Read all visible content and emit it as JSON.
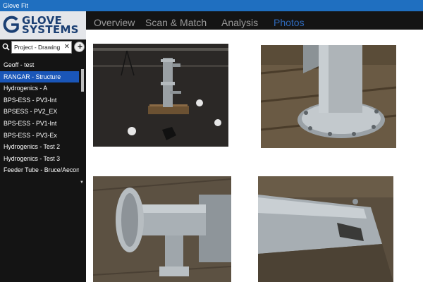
{
  "app": {
    "title": "Glove Fit"
  },
  "brand": {
    "line1": "GLOVE",
    "line2": "SYSTEMS"
  },
  "search": {
    "value": "Project - Drawing",
    "clear_glyph": "✕"
  },
  "sidebar": {
    "add_glyph": "+",
    "items": [
      {
        "label": "Geoff - test"
      },
      {
        "label": "RANGAR - Structure",
        "selected": true
      },
      {
        "label": "Hydrogenics - A"
      },
      {
        "label": "BPS-ESS - PV3-Int"
      },
      {
        "label": "BPSESS - PV2_EX"
      },
      {
        "label": "BPS-ESS - PV1-Int"
      },
      {
        "label": "BPS-ESS - PV3-Ex"
      },
      {
        "label": "Hydrogenics - Test 2"
      },
      {
        "label": "Hydrogenics - Test 3"
      },
      {
        "label": "Feeder Tube - Bruce/Aecon"
      }
    ]
  },
  "tabs": [
    {
      "label": "Overview"
    },
    {
      "label": "Scan & Match"
    },
    {
      "label": "Analysis"
    },
    {
      "label": "Photos",
      "active": true
    }
  ],
  "photos": [
    {
      "subject": "pipe-assembly-on-pallet-dark-room"
    },
    {
      "subject": "flanged-pipe-on-wooden-pallet"
    },
    {
      "subject": "flanged-pipe-tee-closeup"
    },
    {
      "subject": "cut-pipe-closeup"
    }
  ],
  "colors": {
    "titlebar": "#1f6fc0",
    "chrome": "#141414",
    "selected": "#1a56b8",
    "active_tab": "#2e68b8",
    "inactive_tab": "#9a9a9a",
    "brand": "#1b3f73"
  }
}
